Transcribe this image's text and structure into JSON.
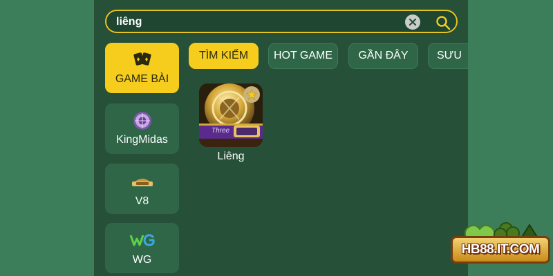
{
  "search": {
    "value": "liêng",
    "clear_icon": "close-icon",
    "search_icon": "search-icon"
  },
  "categories": [
    {
      "label": "GAME BÀI",
      "icon": "cards-icon",
      "active": true
    },
    {
      "label": "KingMidas",
      "icon": "kingmidas-logo-icon",
      "active": false
    },
    {
      "label": "V8",
      "icon": "v8-logo-icon",
      "active": false
    },
    {
      "label": "WG",
      "icon": "wg-logo-icon",
      "active": false
    }
  ],
  "tabs": [
    {
      "label": "TÌM KIẾM",
      "active": true
    },
    {
      "label": "HOT GAME",
      "active": false
    },
    {
      "label": "GẦN ĐÂY",
      "active": false
    },
    {
      "label": "SƯU",
      "active": false
    }
  ],
  "games": [
    {
      "name": "Liêng",
      "thumbnail_text": "Three",
      "favorite_icon": "star-icon"
    }
  ],
  "watermark": {
    "text": "HB88.IT.COM"
  },
  "colors": {
    "accent": "#f6cc1d",
    "panel": "#275038",
    "tile": "#2e6647",
    "background": "#3d7e5a"
  }
}
